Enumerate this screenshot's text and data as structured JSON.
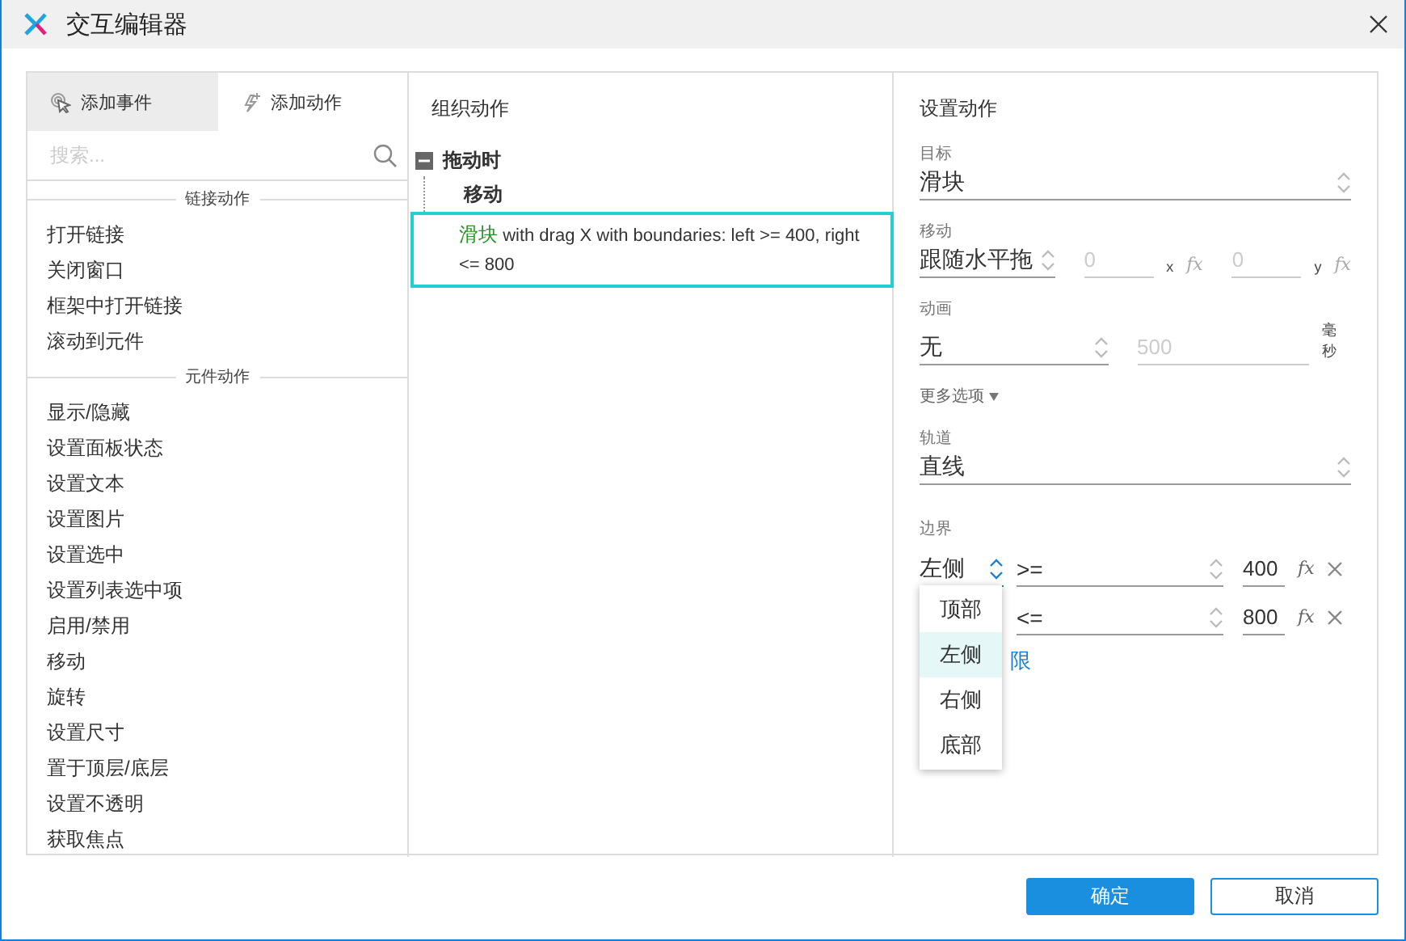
{
  "window": {
    "title": "交互编辑器"
  },
  "left_panel": {
    "tabs": [
      {
        "label": "添加事件",
        "selected": true,
        "kind": "event"
      },
      {
        "label": "添加动作",
        "selected": false,
        "kind": "action"
      }
    ],
    "search": {
      "placeholder": "搜索..."
    },
    "groups": [
      {
        "heading": "链接动作",
        "items": [
          "打开链接",
          "关闭窗口",
          "框架中打开链接",
          "滚动到元件"
        ]
      },
      {
        "heading": "元件动作",
        "items": [
          "显示/隐藏",
          "设置面板状态",
          "设置文本",
          "设置图片",
          "设置选中",
          "设置列表选中项",
          "启用/禁用",
          "移动",
          "旋转",
          "设置尺寸",
          "置于顶层/底层",
          "设置不透明",
          "获取焦点"
        ]
      }
    ]
  },
  "middle_panel": {
    "title": "组织动作",
    "tree": [
      {
        "label": "拖动时",
        "expanded": true,
        "children": [
          {
            "label": "移动",
            "children": [
              {
                "target": "滑块",
                "text": "with drag X  with boundaries: left >= 400, right <= 800",
                "selected": true
              }
            ]
          }
        ]
      }
    ]
  },
  "right_panel": {
    "title": "设置动作",
    "target": {
      "label": "目标",
      "value": "滑块"
    },
    "move": {
      "label": "移动",
      "value": "跟随水平拖",
      "x": {
        "value": "0",
        "unit": "x",
        "formula": "fx",
        "disabled": true
      },
      "y": {
        "value": "0",
        "unit": "y",
        "formula": "fx",
        "disabled": true
      }
    },
    "animation": {
      "label": "动画",
      "value": "无",
      "duration": {
        "value": "500",
        "disabled": true
      },
      "unit": "毫秒"
    },
    "more_options": {
      "label": "更多选项",
      "expanded": false
    },
    "track": {
      "label": "轨道",
      "value": "直线"
    },
    "boundaries": {
      "label": "边界",
      "rows": [
        {
          "side": "左侧",
          "operator": ">=",
          "value": "400",
          "formula": "fx"
        },
        {
          "operator": "<=",
          "value": "800",
          "formula": "fx"
        }
      ],
      "add_link": "限",
      "dropdown": {
        "options": [
          {
            "label": "顶部",
            "selected": false
          },
          {
            "label": "左侧",
            "selected": true
          },
          {
            "label": "右侧",
            "selected": false
          },
          {
            "label": "底部",
            "selected": false
          }
        ]
      }
    }
  },
  "buttons": [
    {
      "label": "确定",
      "kind": "primary"
    },
    {
      "label": "取消",
      "kind": "secondary"
    }
  ]
}
